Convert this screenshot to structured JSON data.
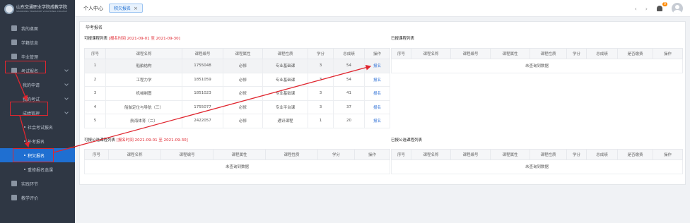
{
  "sidebar": {
    "logo_text": "山东交通职业学院成教学院",
    "logo_subtext": "SHANDONG TRANSPORT VOCATIONAL COLLEGE",
    "items": [
      {
        "label": "我的桌面",
        "icon": "desktop-icon"
      },
      {
        "label": "学籍信息",
        "icon": "info-icon"
      },
      {
        "label": "毕业管理",
        "icon": "graduation-icon"
      },
      {
        "label": "考试报名",
        "icon": "register-icon"
      },
      {
        "label": "我的申请"
      },
      {
        "label": "我的考试"
      },
      {
        "label": "成绩管理"
      },
      {
        "label": "社会考试报名"
      },
      {
        "label": "补考报名"
      },
      {
        "label": "积欠报名"
      },
      {
        "label": "重修报名选课"
      },
      {
        "label": "实践环节",
        "icon": "practice-icon"
      },
      {
        "label": "教学评价",
        "icon": "evaluation-icon"
      }
    ]
  },
  "topbar": {
    "breadcrumb": "个人中心",
    "active_tab": "积欠报名",
    "close_glyph": "×",
    "prev_glyph": "‹",
    "next_glyph": "›",
    "badge_count": "0"
  },
  "main": {
    "panel_title": "毕考报名",
    "left_top": {
      "title": "可报课程列表",
      "period": "[报名时间 2021-09-01 至 2021-09-30]",
      "headers": [
        "序号",
        "课程名称",
        "课程编号",
        "课程属性",
        "课程性质",
        "学分",
        "总成绩",
        "操作"
      ],
      "rows": [
        [
          "1",
          "船舶结构",
          "1755048",
          "必修",
          "专业基础课",
          "3",
          "54",
          "报名"
        ],
        [
          "2",
          "工程力学",
          "1851059",
          "必修",
          "专业基础课",
          "3",
          "54",
          "报名"
        ],
        [
          "3",
          "机械制图",
          "1851023",
          "必修",
          "专业基础课",
          "3",
          "41",
          "报名"
        ],
        [
          "4",
          "船舶定位与导航（三）",
          "1755077",
          "必修",
          "专业平台课",
          "3",
          "37",
          "报名"
        ],
        [
          "5",
          "航海体育（二）",
          "2422057",
          "必修",
          "通识课程",
          "1",
          "20",
          "报名"
        ]
      ]
    },
    "right_top": {
      "title": "已报课程列表",
      "headers": [
        "序号",
        "课程名称",
        "课程编号",
        "课程属性",
        "课程性质",
        "学分",
        "总成绩",
        "是否缴费",
        "操作"
      ],
      "empty": "未查询到数据"
    },
    "left_bottom": {
      "title": "可报公选课程列表",
      "period": "[报名时间 2021-09-01 至 2021-09-30]",
      "headers": [
        "序号",
        "课程名称",
        "课程编号",
        "课程属性",
        "课程性质",
        "学分",
        "操作"
      ],
      "empty": "未查询到数据"
    },
    "right_bottom": {
      "title": "已报公选课程列表",
      "headers": [
        "序号",
        "课程名称",
        "课程编号",
        "课程属性",
        "课程性质",
        "学分",
        "总成绩",
        "是否缴费",
        "操作"
      ],
      "empty": "未查询到数据"
    }
  },
  "colors": {
    "sidebar_bg": "#2f3744",
    "active_blue": "#1f6fd1",
    "annotation_red": "#e0262f",
    "link_blue": "#3a78d8"
  }
}
